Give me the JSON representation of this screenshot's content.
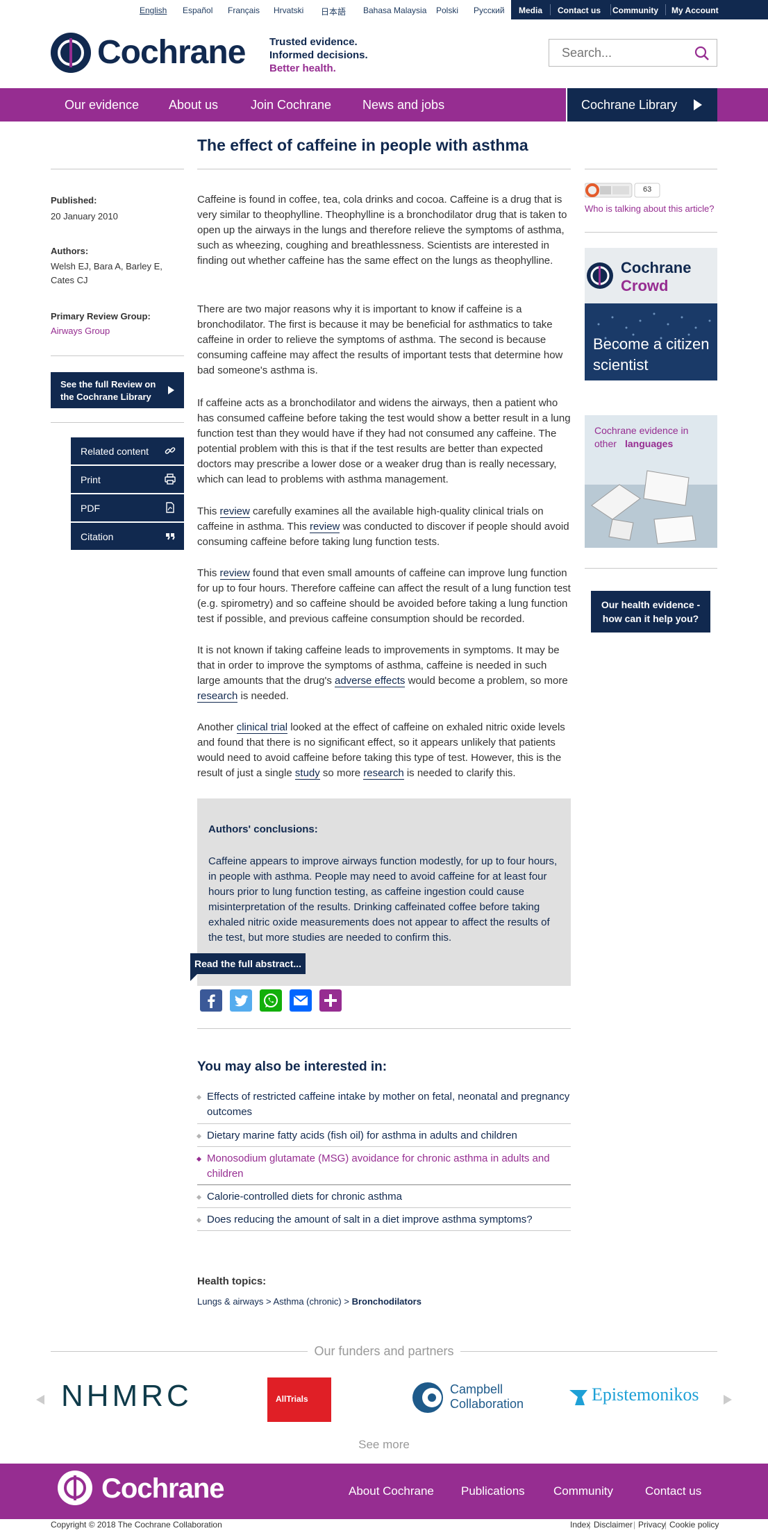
{
  "languages": [
    "English",
    "Español",
    "Français",
    "Hrvatski",
    "日本語",
    "Bahasa Malaysia",
    "Polski",
    "Русский"
  ],
  "top_links": [
    "Media",
    "Contact us",
    "Community",
    "My Account"
  ],
  "brand": {
    "name": "Cochrane",
    "tagline_1": "Trusted evidence.",
    "tagline_2": "Informed decisions.",
    "tagline_3": "Better health.",
    "purple": "#962d91",
    "navy": "#11294f"
  },
  "search": {
    "placeholder": "Search..."
  },
  "main_nav": [
    "Our evidence",
    "About us",
    "Join Cochrane",
    "News and jobs"
  ],
  "library_button": "Cochrane Library",
  "article": {
    "title": "The effect of caffeine in people with asthma",
    "published_label": "Published:",
    "published_date": "20 January 2010",
    "authors_label": "Authors:",
    "authors": "Welsh EJ, Bara A, Barley E, Cates CJ",
    "review_group_label": "Primary Review Group:",
    "review_group": "Airways Group",
    "full_review_button": "See the full Review on the Cochrane Library",
    "side_menu": [
      "Related content",
      "Print",
      "PDF",
      "Citation"
    ],
    "p1": "Caffeine is found in coffee, tea, cola drinks and cocoa. Caffeine is a drug that is very similar to theophylline. Theophylline is a bronchodilator drug that is taken to open up the airways in the lungs and therefore relieve the symptoms of asthma, such as wheezing, coughing and breathlessness. Scientists are interested in finding out whether caffeine has the same effect on the lungs as theophylline.",
    "p2": "There are two major reasons why it is important to know if caffeine is a bronchodilator. The first is because it may be beneficial for asthmatics to take caffeine in order to relieve the symptoms of asthma. The second is because consuming caffeine may affect the results of important tests that determine how bad someone's asthma is.",
    "p3": "If caffeine acts as a bronchodilator and widens the airways, then a patient who has consumed caffeine before taking the test would show a better result in a lung function test than they would have if they had not consumed any caffeine. The potential problem with this is that if the test results are better than expected doctors may prescribe a lower dose or a weaker drug than is really necessary, which can lead to problems with asthma management.",
    "p4_a": "This ",
    "p4_link1": "review",
    "p4_b": " carefully examines all the available high-quality clinical trials on caffeine in asthma. This ",
    "p4_link2": "review",
    "p4_c": " was conducted to discover if people should avoid consuming caffeine before taking lung function tests.",
    "p5_a": "This ",
    "p5_link": "review",
    "p5_b": " found that even small amounts of caffeine can improve lung function for up to four hours. Therefore caffeine can affect the result of a lung function test (e.g. spirometry) and so caffeine should be avoided before taking a lung function test if possible, and previous caffeine consumption should be recorded.",
    "p6_a": "It is not known if taking caffeine leads to improvements in symptoms. It may be that in order to improve the symptoms of asthma, caffeine is needed in such large amounts that the drug's ",
    "p6_link1": "adverse effects",
    "p6_b": " would become a problem, so more ",
    "p6_link2": "research",
    "p6_c": " is needed.",
    "p7_a": "Another ",
    "p7_link1": "clinical trial",
    "p7_b": " looked at the effect of caffeine on exhaled nitric oxide levels and found that there is no significant effect, so it appears unlikely that patients would need to avoid caffeine before taking this type of test. However, this is the result of just a single ",
    "p7_link2": "study",
    "p7_c": " so more ",
    "p7_link3": "research",
    "p7_d": " is needed to clarify this.",
    "conclusions_title": "Authors' conclusions:",
    "conclusions_text": "Caffeine appears to improve airways function modestly, for up to four hours, in people with asthma. People may need to avoid caffeine for at least four hours prior to lung function testing, as caffeine ingestion could cause misinterpretation of the results. Drinking caffeinated coffee before taking exhaled nitric oxide measurements does not appear to affect the results of the test, but more studies are needed to confirm this.",
    "read_full_abstract": "Read the full abstract..."
  },
  "also_interested": {
    "title": "You may also be interested in:",
    "items": [
      "Effects of restricted caffeine intake by mother on fetal, neonatal and pregnancy outcomes",
      "Dietary marine fatty acids (fish oil) for asthma in adults and children",
      "Monosodium glutamate (MSG) avoidance for chronic asthma in adults and children",
      "Calorie-controlled diets for chronic asthma",
      "Does reducing the amount of salt in a diet improve asthma symptoms?"
    ]
  },
  "health_topics": {
    "label": "Health topics:",
    "crumb_1": "Lungs & airways",
    "crumb_2": "Asthma (chronic)",
    "crumb_3": "Bronchodilators"
  },
  "sidebar": {
    "altmetric_score": "63",
    "altmetric_link": "Who is talking about this article?",
    "crowd_title_1": "Cochrane",
    "crowd_title_2": "Crowd",
    "crowd_cta": "Become a citizen scientist",
    "languages_title_1": "Cochrane evidence in",
    "languages_title_2": "other",
    "languages_title_3": "languages",
    "health_button": "Our health evidence - how can it help you?"
  },
  "funders": {
    "title": "Our funders and partners",
    "logos": [
      "NHMRC",
      "AllTrials",
      "Campbell Collaboration",
      "Epistemonikos"
    ],
    "see_more": "See more"
  },
  "footer": {
    "links": [
      "About Cochrane",
      "Publications",
      "Community",
      "Contact us"
    ],
    "copyright": "Copyright © 2018 The Cochrane Collaboration",
    "legal": [
      "Index",
      "Disclaimer",
      "Privacy",
      "Cookie policy"
    ]
  }
}
